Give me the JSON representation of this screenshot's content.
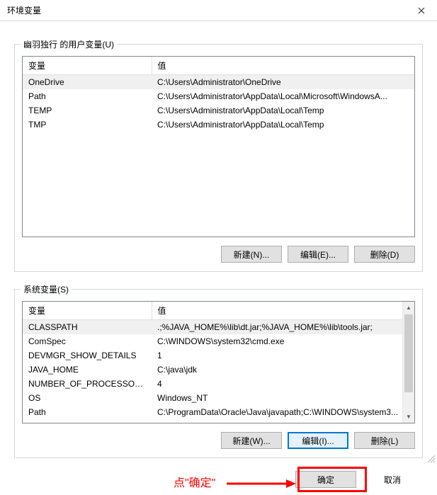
{
  "titlebar": {
    "title": "环境变量"
  },
  "user_group": {
    "label": "幽羽独行 的用户变量(U)",
    "headers": {
      "name": "变量",
      "value": "值"
    },
    "rows": [
      {
        "name": "OneDrive",
        "value": "C:\\Users\\Administrator\\OneDrive",
        "selected": true
      },
      {
        "name": "Path",
        "value": "C:\\Users\\Administrator\\AppData\\Local\\Microsoft\\WindowsA...",
        "selected": false
      },
      {
        "name": "TEMP",
        "value": "C:\\Users\\Administrator\\AppData\\Local\\Temp",
        "selected": false
      },
      {
        "name": "TMP",
        "value": "C:\\Users\\Administrator\\AppData\\Local\\Temp",
        "selected": false
      }
    ],
    "buttons": {
      "new": "新建(N)...",
      "edit": "编辑(E)...",
      "delete": "删除(D)"
    }
  },
  "sys_group": {
    "label": "系统变量(S)",
    "headers": {
      "name": "变量",
      "value": "值"
    },
    "rows": [
      {
        "name": "CLASSPATH",
        "value": ".;%JAVA_HOME%\\lib\\dt.jar;%JAVA_HOME%\\lib\\tools.jar;",
        "selected": true
      },
      {
        "name": "ComSpec",
        "value": "C:\\WINDOWS\\system32\\cmd.exe",
        "selected": false
      },
      {
        "name": "DEVMGR_SHOW_DETAILS",
        "value": "1",
        "selected": false
      },
      {
        "name": "JAVA_HOME",
        "value": "C:\\java\\jdk",
        "selected": false
      },
      {
        "name": "NUMBER_OF_PROCESSORS",
        "value": "4",
        "selected": false
      },
      {
        "name": "OS",
        "value": "Windows_NT",
        "selected": false
      },
      {
        "name": "Path",
        "value": "C:\\ProgramData\\Oracle\\Java\\javapath;C:\\WINDOWS\\system3...",
        "selected": false
      }
    ],
    "buttons": {
      "new": "新建(W)...",
      "edit": "编辑(I)...",
      "delete": "删除(L)"
    }
  },
  "dialog_buttons": {
    "ok": "确定",
    "cancel": "取消"
  },
  "annotation": {
    "text": "点\"确定\""
  }
}
